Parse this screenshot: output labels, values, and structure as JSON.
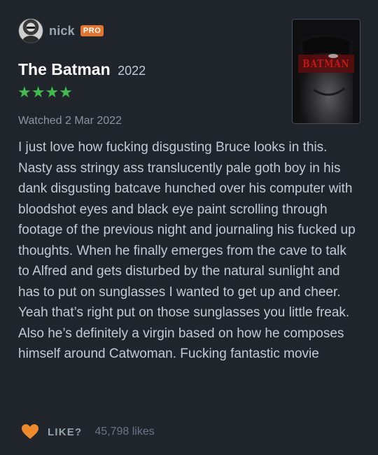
{
  "author": {
    "name": "nick",
    "badge": "PRO"
  },
  "film": {
    "title": "The Batman",
    "year": "2022",
    "rating_stars": 4,
    "star_glyph": "★★★★",
    "poster_title": "BATMAN"
  },
  "review": {
    "watched": "Watched 2 Mar 2022",
    "text": "I just love how fucking disgusting Bruce looks in this. Nasty ass stringy ass translucently pale goth boy in his dank disgusting batcave hunched over his computer with bloodshot eyes and black eye paint scrolling through footage of the previous night and journaling his fucked up thoughts. When he finally emerges from the cave to talk to Alfred and gets disturbed by the natural sunlight and has to put on sunglasses I wanted to get up and cheer. Yeah that’s right put on those sunglasses you little freak. Also he’s definitely a virgin based on how he composes himself around Catwoman. Fucking fantastic movie"
  },
  "like": {
    "label": "LIKE?",
    "count": "45,798 likes"
  },
  "colors": {
    "background": "#20242b",
    "star_green": "#40bc4b",
    "heart_orange": "#ef8a2b",
    "pro_orange": "#e4762f"
  },
  "icons": [
    "avatar",
    "heart-icon",
    "star-icon"
  ]
}
